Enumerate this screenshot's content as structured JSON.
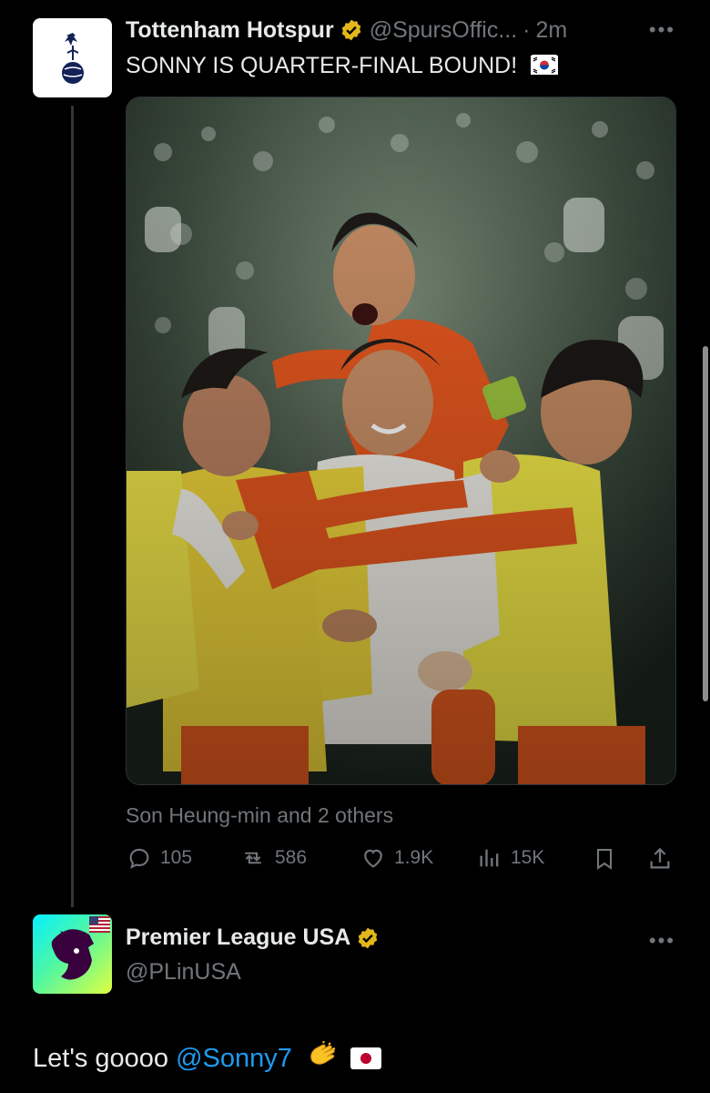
{
  "tweet1": {
    "display_name": "Tottenham Hotspur",
    "handle": "@SpursOffic...",
    "separator": "·",
    "time": "2m",
    "text": "SONNY IS QUARTER-FINAL BOUND!",
    "flag": "south-korea-flag-icon",
    "tagged": "Son Heung-min and 2 others",
    "stats": {
      "replies": "105",
      "retweets": "586",
      "likes": "1.9K",
      "views": "15K"
    }
  },
  "tweet2": {
    "display_name": "Premier League USA",
    "handle": "@PLinUSA",
    "text_prefix": "Let's goooo ",
    "mention": "@Sonny7",
    "emoji": "clapping-hands-icon",
    "flag": "japan-flag-icon"
  },
  "colors": {
    "background": "#000000",
    "text": "#e7e9ea",
    "muted": "#71767b",
    "link": "#1d9bf0",
    "verified_gold": "#e2b719",
    "spurs_navy": "#132257"
  }
}
